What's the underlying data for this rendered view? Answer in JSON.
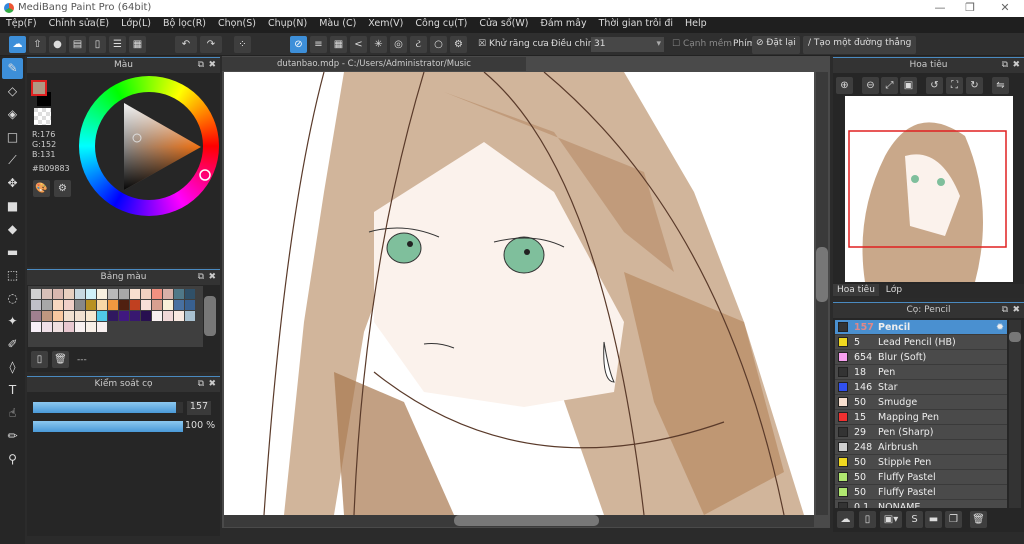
{
  "window": {
    "title": "MediBang Paint Pro (64bit)",
    "minimize": "—",
    "maximize": "❐",
    "close": "✕"
  },
  "menu": [
    "Tệp(F)",
    "Chỉnh sửa(E)",
    "Lớp(L)",
    "Bộ lọc(R)",
    "Chọn(S)",
    "Chụp(N)",
    "Màu (C)",
    "Xem(V)",
    "Công cụ(T)",
    "Cửa sổ(W)",
    "Đám mây",
    "Thời gian trôi đi",
    "Help"
  ],
  "toolbar": {
    "antialias_label": "Khử răng cưa",
    "adjust_label": "Điều chỉnh",
    "adjust_value": "31",
    "soft_edge_label": "Cạnh mềm",
    "key_label": "Phím",
    "reset_label": "Đặt lại",
    "straight_line_label": "Tạo một đường thẳng"
  },
  "color_panel": {
    "title": "Màu",
    "r": "R:176",
    "g": "G:152",
    "b": "B:131",
    "hex": "#B09883",
    "fg_color": "#b09883",
    "bg_color": "#000000"
  },
  "palette_panel": {
    "title": "Bảng màu",
    "name": "---",
    "colors": [
      "#d0d0d0",
      "#d8c0b8",
      "#d8b8b0",
      "#e8d0c0",
      "#c8d8e0",
      "#d0f0f8",
      "#f8f0e0",
      "#b8b8b8",
      "#a8a8a8",
      "#f8e0d0",
      "#f0d0c0",
      "#f09080",
      "#d8b0a8",
      "#507888",
      "#305068",
      "#c0c0c8",
      "#a8a8a8",
      "#f8d8c0",
      "#f0d0c8",
      "#888888",
      "#b89020",
      "#f8d8a8",
      "#f09840",
      "#502010",
      "#c04020",
      "#f8e0d8",
      "#d8a090",
      "#f8f0d8",
      "#4870a0",
      "#386090",
      "#a08090",
      "#c09880",
      "#f8c8a0",
      "#f0e0d0",
      "#f0e0d0",
      "#f8e8d0",
      "#50c8e8",
      "#301860",
      "#401880",
      "#381870",
      "#281050",
      "#f8f0f0",
      "#f0d8d8",
      "#f8e8e0",
      "#a8c0d0",
      "#f8f0f8",
      "#f0e0e8",
      "#f0e0e0",
      "#e8c8d0",
      "#f8f0f0",
      "#f8f0e8",
      "#f8f0f0"
    ]
  },
  "brush_control": {
    "title": "Kiểm soát cọ",
    "size": "157",
    "opacity": "100 %",
    "size_fraction": 0.95,
    "opacity_fraction": 1.0
  },
  "document": {
    "tab": "dutanbao.mdp - C:/Users/Administrator/Music"
  },
  "navigator": {
    "title": "Hoa tiêu",
    "tabs": [
      "Hoa tiêu",
      "Lớp"
    ]
  },
  "brush_panel": {
    "title": "Cọ: Pencil",
    "items": [
      {
        "size": "157",
        "name": "Pencil",
        "color": "#333333",
        "selected": true
      },
      {
        "size": "5",
        "name": "Lead Pencil (HB)",
        "color": "#f0d820"
      },
      {
        "size": "654",
        "name": "Blur (Soft)",
        "color": "#f8a0f0"
      },
      {
        "size": "18",
        "name": "Pen",
        "color": "#333333"
      },
      {
        "size": "146",
        "name": "Star",
        "color": "#3050f0"
      },
      {
        "size": "50",
        "name": "Smudge",
        "color": "#f8e0d0"
      },
      {
        "size": "15",
        "name": "Mapping Pen",
        "color": "#f03030"
      },
      {
        "size": "29",
        "name": "Pen (Sharp)",
        "color": "#333333"
      },
      {
        "size": "248",
        "name": "Airbrush",
        "color": "#d0d0d0"
      },
      {
        "size": "50",
        "name": "Stipple Pen",
        "color": "#f0d820"
      },
      {
        "size": "50",
        "name": "Fluffy Pastel",
        "color": "#b0e870"
      },
      {
        "size": "50",
        "name": "Fluffy Pastel",
        "color": "#b0e870"
      },
      {
        "size": "0.1",
        "name": "NONAME",
        "color": "#333333"
      }
    ]
  },
  "accent": "#3d8fd9"
}
